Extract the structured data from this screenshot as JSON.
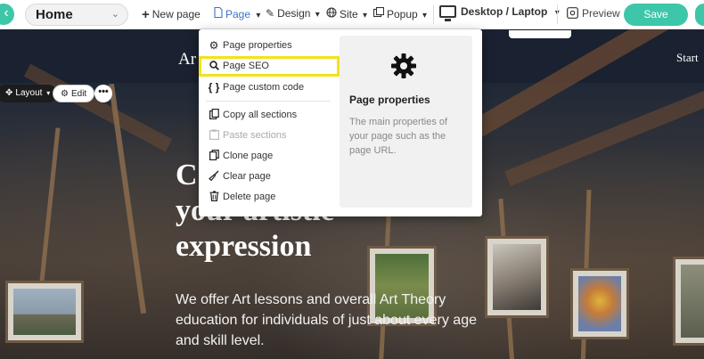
{
  "toolbar": {
    "page_select": "Home",
    "new_page": "New page",
    "page_menu": "Page",
    "design_menu": "Design",
    "site_menu": "Site",
    "popup_menu": "Popup",
    "device": "Desktop / Laptop",
    "preview": "Preview",
    "save": "Save"
  },
  "site": {
    "brand": "Ar",
    "nav_start": "Start",
    "headline": [
      "C",
      "your artistic",
      "expression"
    ],
    "description": "We offer Art lessons and overall Art Theory education for individuals of just about every age and skill level."
  },
  "section_controls": {
    "layout": "Layout",
    "edit": "Edit",
    "more": "•••"
  },
  "page_menu": {
    "items": [
      {
        "label": "Page properties",
        "icon": "gear-icon",
        "enabled": true
      },
      {
        "label": "Page SEO",
        "icon": "search-icon",
        "enabled": true,
        "highlighted": true
      },
      {
        "label": "Page custom code",
        "icon": "curly-braces-icon",
        "enabled": true
      },
      {
        "label": "Copy all sections",
        "icon": "copy-icon",
        "enabled": true
      },
      {
        "label": "Paste sections",
        "icon": "paste-icon",
        "enabled": false
      },
      {
        "label": "Clone page",
        "icon": "clone-icon",
        "enabled": true
      },
      {
        "label": "Clear page",
        "icon": "broom-icon",
        "enabled": true
      },
      {
        "label": "Delete page",
        "icon": "trash-icon",
        "enabled": true
      }
    ],
    "info": {
      "title": "Page properties",
      "text": "The main properties of your page such as the page URL."
    }
  },
  "colors": {
    "accent": "#3ec6a8",
    "active_menu": "#3b73c8",
    "highlight": "#f2e21c"
  }
}
